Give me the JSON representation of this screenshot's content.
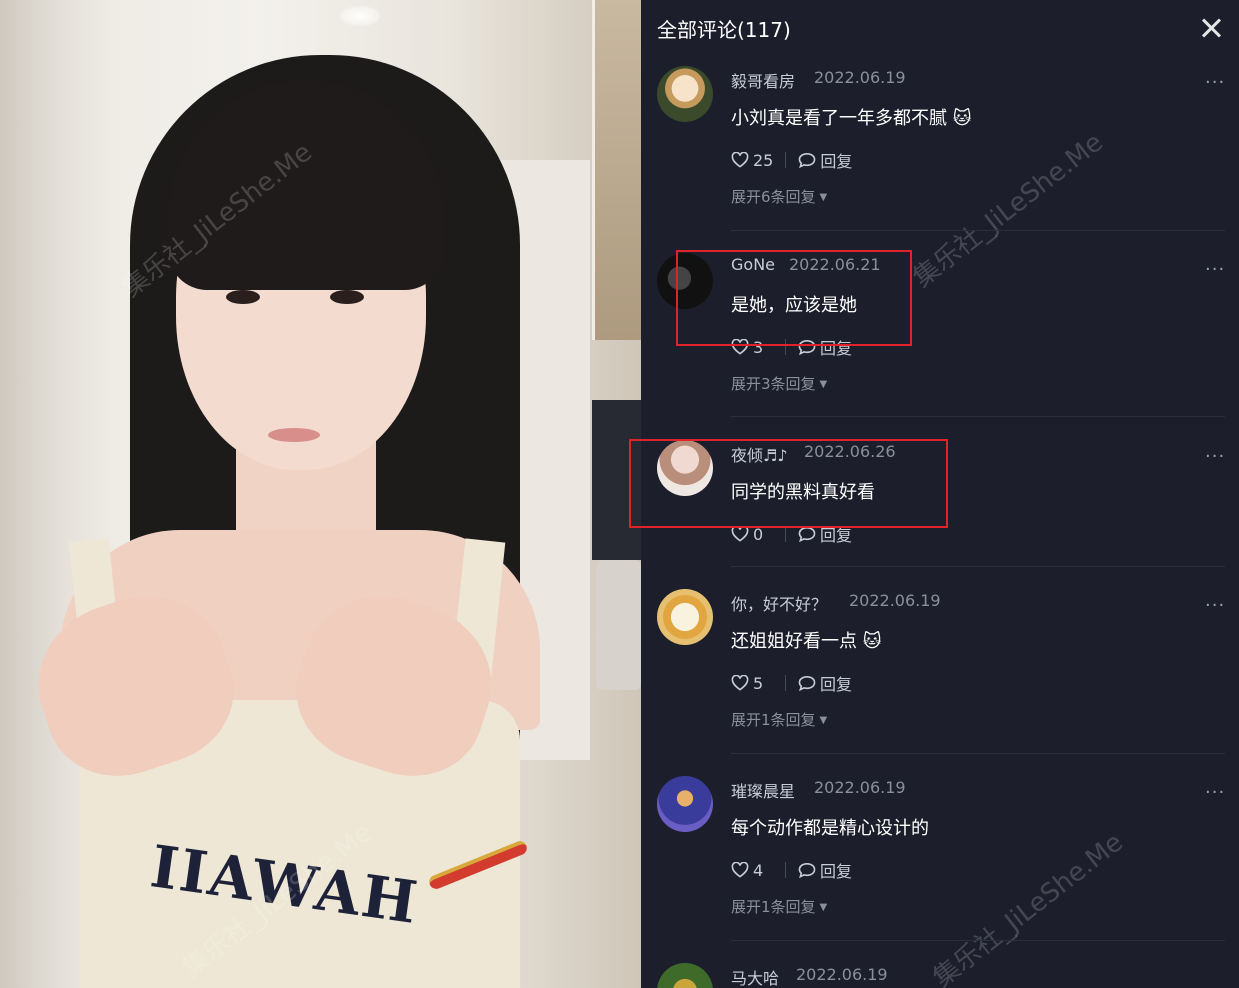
{
  "video": {
    "shirt_text": "IIAWAH",
    "watermark_text": "集乐社_JiLeShe.Me"
  },
  "panel": {
    "title": "全部评论(117)"
  },
  "comments": [
    {
      "username": "毅哥看房",
      "date": "2022.06.19",
      "text": "小刘真是看了一年多都不腻 🐱",
      "likes": "25",
      "reply_label": "回复",
      "expand": "展开6条回复"
    },
    {
      "username": "GoNe",
      "date": "2022.06.21",
      "text": "是她，应该是她",
      "likes": "3",
      "reply_label": "回复",
      "expand": "展开3条回复"
    },
    {
      "username": "夜倾♬♪",
      "date": "2022.06.26",
      "text": "同学的黑料真好看",
      "likes": "0",
      "reply_label": "回复",
      "expand": ""
    },
    {
      "username": "你，好不好？",
      "date": "2022.06.19",
      "text": "还姐姐好看一点 🐱",
      "likes": "5",
      "reply_label": "回复",
      "expand": "展开1条回复"
    },
    {
      "username": "璀璨晨星",
      "date": "2022.06.19",
      "text": "每个动作都是精心设计的",
      "likes": "4",
      "reply_label": "回复",
      "expand": "展开1条回复"
    },
    {
      "username": "马大哈",
      "date": "2022.06.19",
      "text": "",
      "likes": "",
      "reply_label": "",
      "expand": ""
    }
  ],
  "colors": {
    "panel_bg": "#1c1f2b",
    "highlight": "#e0222a"
  }
}
